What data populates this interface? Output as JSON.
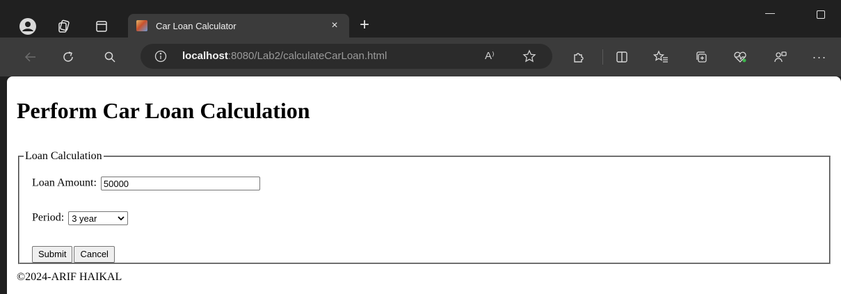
{
  "browser": {
    "tab": {
      "title": "Car Loan Calculator",
      "close_glyph": "×"
    },
    "new_tab_glyph": "+",
    "minimize_glyph": "—",
    "address": {
      "host": "localhost",
      "path": ":8080/Lab2/calculateCarLoan.html",
      "read_aloud_label": "A⁾"
    },
    "icons": {
      "profile": "profile-icon",
      "workspaces": "workspaces-icon",
      "tab_actions": "tab-actions-icon",
      "back": "back-arrow-icon",
      "refresh": "refresh-icon",
      "search": "search-icon",
      "info": "info-icon",
      "favorite": "star-icon",
      "extensions": "extensions-icon",
      "split_screen": "split-screen-icon",
      "favorites": "favorites-icon",
      "collections": "collections-icon",
      "health": "browser-essentials-icon",
      "copilot": "copilot-icon",
      "more": "more-icon"
    },
    "more_glyph": "···"
  },
  "page": {
    "heading": "Perform Car Loan Calculation",
    "fieldset_legend": "Loan Calculation",
    "loan_amount_label": "Loan Amount:",
    "loan_amount_value": "50000",
    "period_label": "Period:",
    "period_selected": "3 year",
    "submit_label": "Submit",
    "cancel_label": "Cancel",
    "footer": "©2024-ARIF HAIKAL"
  },
  "colors": {
    "tabbar_bg": "#202020",
    "toolbar_bg": "#3b3b3b",
    "page_bg": "#ffffff"
  }
}
